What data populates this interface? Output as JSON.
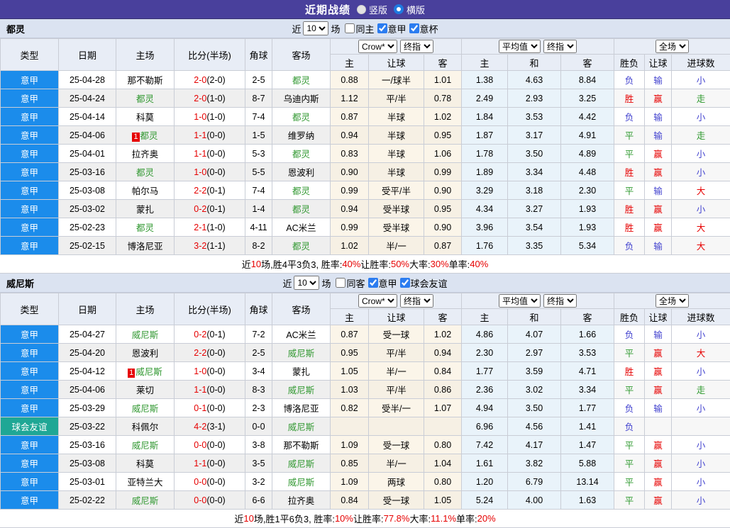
{
  "title_bar": {
    "title": "近期战绩",
    "vertical_label": "竖版",
    "horizontal_label": "横版",
    "vertical_selected": false,
    "horizontal_selected": true
  },
  "colors": {
    "titlebar_bg": "#49409c",
    "league_badge": "#1b8ceb",
    "friendly_badge": "#1fa795",
    "focus_team": "#339933",
    "win_red": "#e60000",
    "draw_green": "#2e992e",
    "lose_blue": "#4343cf",
    "odds_bg": "#fbf5e9",
    "avg_bg": "#e9f3fa"
  },
  "shared": {
    "filter": {
      "near": "近",
      "count": "10",
      "games": "场"
    },
    "dropdowns": {
      "bookmaker": "Crow*",
      "final_1": "终指",
      "average": "平均值",
      "final_2": "终指",
      "scope": "全场"
    },
    "columns": {
      "type": "类型",
      "date": "日期",
      "home": "主场",
      "score": "比分(半场)",
      "corner": "角球",
      "away": "客场",
      "odds_home": "主",
      "odds_handicap": "让球",
      "odds_away": "客",
      "avg_home": "主",
      "avg_draw": "和",
      "avg_away": "客",
      "wdl": "胜负",
      "handicap_result": "让球",
      "goals": "进球数"
    }
  },
  "tables": [
    {
      "team": "都灵",
      "filter_checkboxes": [
        {
          "label": "同主",
          "checked": false
        },
        {
          "label": "意甲",
          "checked": true
        },
        {
          "label": "意杯",
          "checked": true
        }
      ],
      "rows": [
        {
          "type": "意甲",
          "type_style": "league",
          "date": "25-04-28",
          "home": "那不勒斯",
          "home_focus": false,
          "home_badge": "",
          "score": "2-0",
          "half": "(2-0)",
          "corner": "2-5",
          "away": "都灵",
          "away_focus": true,
          "away_badge": "",
          "odds": [
            "0.88",
            "一/球半",
            "1.01"
          ],
          "avg": [
            "1.38",
            "4.63",
            "8.84"
          ],
          "results": [
            [
              "负",
              "b"
            ],
            [
              "输",
              "b"
            ],
            [
              "小",
              "b"
            ]
          ]
        },
        {
          "type": "意甲",
          "type_style": "league",
          "date": "25-04-24",
          "home": "都灵",
          "home_focus": true,
          "home_badge": "",
          "score": "2-0",
          "half": "(1-0)",
          "corner": "8-7",
          "away": "乌迪内斯",
          "away_focus": false,
          "away_badge": "",
          "odds": [
            "1.12",
            "平/半",
            "0.78"
          ],
          "avg": [
            "2.49",
            "2.93",
            "3.25"
          ],
          "results": [
            [
              "胜",
              "r"
            ],
            [
              "赢",
              "r"
            ],
            [
              "走",
              "g"
            ]
          ]
        },
        {
          "type": "意甲",
          "type_style": "league",
          "date": "25-04-14",
          "home": "科莫",
          "home_focus": false,
          "home_badge": "",
          "score": "1-0",
          "half": "(1-0)",
          "corner": "7-4",
          "away": "都灵",
          "away_focus": true,
          "away_badge": "",
          "odds": [
            "0.87",
            "半球",
            "1.02"
          ],
          "avg": [
            "1.84",
            "3.53",
            "4.42"
          ],
          "results": [
            [
              "负",
              "b"
            ],
            [
              "输",
              "b"
            ],
            [
              "小",
              "b"
            ]
          ]
        },
        {
          "type": "意甲",
          "type_style": "league",
          "date": "25-04-06",
          "home": "都灵",
          "home_focus": true,
          "home_badge": "1",
          "score": "1-1",
          "half": "(0-0)",
          "corner": "1-5",
          "away": "维罗纳",
          "away_focus": false,
          "away_badge": "",
          "odds": [
            "0.94",
            "半球",
            "0.95"
          ],
          "avg": [
            "1.87",
            "3.17",
            "4.91"
          ],
          "results": [
            [
              "平",
              "g"
            ],
            [
              "输",
              "b"
            ],
            [
              "走",
              "g"
            ]
          ]
        },
        {
          "type": "意甲",
          "type_style": "league",
          "date": "25-04-01",
          "home": "拉齐奥",
          "home_focus": false,
          "home_badge": "",
          "score": "1-1",
          "half": "(0-0)",
          "corner": "5-3",
          "away": "都灵",
          "away_focus": true,
          "away_badge": "",
          "odds": [
            "0.83",
            "半球",
            "1.06"
          ],
          "avg": [
            "1.78",
            "3.50",
            "4.89"
          ],
          "results": [
            [
              "平",
              "g"
            ],
            [
              "赢",
              "r"
            ],
            [
              "小",
              "b"
            ]
          ]
        },
        {
          "type": "意甲",
          "type_style": "league",
          "date": "25-03-16",
          "home": "都灵",
          "home_focus": true,
          "home_badge": "",
          "score": "1-0",
          "half": "(0-0)",
          "corner": "5-5",
          "away": "恩波利",
          "away_focus": false,
          "away_badge": "",
          "odds": [
            "0.90",
            "半球",
            "0.99"
          ],
          "avg": [
            "1.89",
            "3.34",
            "4.48"
          ],
          "results": [
            [
              "胜",
              "r"
            ],
            [
              "赢",
              "r"
            ],
            [
              "小",
              "b"
            ]
          ]
        },
        {
          "type": "意甲",
          "type_style": "league",
          "date": "25-03-08",
          "home": "帕尔马",
          "home_focus": false,
          "home_badge": "",
          "score": "2-2",
          "half": "(0-1)",
          "corner": "7-4",
          "away": "都灵",
          "away_focus": true,
          "away_badge": "",
          "odds": [
            "0.99",
            "受平/半",
            "0.90"
          ],
          "avg": [
            "3.29",
            "3.18",
            "2.30"
          ],
          "results": [
            [
              "平",
              "g"
            ],
            [
              "输",
              "b"
            ],
            [
              "大",
              "r"
            ]
          ]
        },
        {
          "type": "意甲",
          "type_style": "league",
          "date": "25-03-02",
          "home": "蒙扎",
          "home_focus": false,
          "home_badge": "",
          "score": "0-2",
          "half": "(0-1)",
          "corner": "1-4",
          "away": "都灵",
          "away_focus": true,
          "away_badge": "",
          "odds": [
            "0.94",
            "受半球",
            "0.95"
          ],
          "avg": [
            "4.34",
            "3.27",
            "1.93"
          ],
          "results": [
            [
              "胜",
              "r"
            ],
            [
              "赢",
              "r"
            ],
            [
              "小",
              "b"
            ]
          ]
        },
        {
          "type": "意甲",
          "type_style": "league",
          "date": "25-02-23",
          "home": "都灵",
          "home_focus": true,
          "home_badge": "",
          "score": "2-1",
          "half": "(1-0)",
          "corner": "4-11",
          "away": "AC米兰",
          "away_focus": false,
          "away_badge": "",
          "odds": [
            "0.99",
            "受半球",
            "0.90"
          ],
          "avg": [
            "3.96",
            "3.54",
            "1.93"
          ],
          "results": [
            [
              "胜",
              "r"
            ],
            [
              "赢",
              "r"
            ],
            [
              "大",
              "r"
            ]
          ]
        },
        {
          "type": "意甲",
          "type_style": "league",
          "date": "25-02-15",
          "home": "博洛尼亚",
          "home_focus": false,
          "home_badge": "",
          "score": "3-2",
          "half": "(1-1)",
          "corner": "8-2",
          "away": "都灵",
          "away_focus": true,
          "away_badge": "",
          "odds": [
            "1.02",
            "半/一",
            "0.87"
          ],
          "avg": [
            "1.76",
            "3.35",
            "5.34"
          ],
          "results": [
            [
              "负",
              "b"
            ],
            [
              "输",
              "b"
            ],
            [
              "大",
              "r"
            ]
          ]
        }
      ],
      "summary": [
        [
          "近",
          "k"
        ],
        [
          "10",
          "r"
        ],
        [
          "场,胜4平3负3, 胜率:",
          "k"
        ],
        [
          "40%",
          "r"
        ],
        [
          " 让胜率:",
          "k"
        ],
        [
          "50%",
          "r"
        ],
        [
          " 大率:",
          "k"
        ],
        [
          "30%",
          "r"
        ],
        [
          " 单率:",
          "k"
        ],
        [
          "40%",
          "r"
        ]
      ]
    },
    {
      "team": "威尼斯",
      "filter_checkboxes": [
        {
          "label": "同客",
          "checked": false
        },
        {
          "label": "意甲",
          "checked": true
        },
        {
          "label": "球会友谊",
          "checked": true
        }
      ],
      "rows": [
        {
          "type": "意甲",
          "type_style": "league",
          "date": "25-04-27",
          "home": "威尼斯",
          "home_focus": true,
          "home_badge": "",
          "score": "0-2",
          "half": "(0-1)",
          "corner": "7-2",
          "away": "AC米兰",
          "away_focus": false,
          "away_badge": "",
          "odds": [
            "0.87",
            "受一球",
            "1.02"
          ],
          "avg": [
            "4.86",
            "4.07",
            "1.66"
          ],
          "results": [
            [
              "负",
              "b"
            ],
            [
              "输",
              "b"
            ],
            [
              "小",
              "b"
            ]
          ]
        },
        {
          "type": "意甲",
          "type_style": "league",
          "date": "25-04-20",
          "home": "恩波利",
          "home_focus": false,
          "home_badge": "",
          "score": "2-2",
          "half": "(0-0)",
          "corner": "2-5",
          "away": "威尼斯",
          "away_focus": true,
          "away_badge": "",
          "odds": [
            "0.95",
            "平/半",
            "0.94"
          ],
          "avg": [
            "2.30",
            "2.97",
            "3.53"
          ],
          "results": [
            [
              "平",
              "g"
            ],
            [
              "赢",
              "r"
            ],
            [
              "大",
              "r"
            ]
          ]
        },
        {
          "type": "意甲",
          "type_style": "league",
          "date": "25-04-12",
          "home": "威尼斯",
          "home_focus": true,
          "home_badge": "1",
          "score": "1-0",
          "half": "(0-0)",
          "corner": "3-4",
          "away": "蒙扎",
          "away_focus": false,
          "away_badge": "",
          "odds": [
            "1.05",
            "半/一",
            "0.84"
          ],
          "avg": [
            "1.77",
            "3.59",
            "4.71"
          ],
          "results": [
            [
              "胜",
              "r"
            ],
            [
              "赢",
              "r"
            ],
            [
              "小",
              "b"
            ]
          ]
        },
        {
          "type": "意甲",
          "type_style": "league",
          "date": "25-04-06",
          "home": "莱切",
          "home_focus": false,
          "home_badge": "",
          "score": "1-1",
          "half": "(0-0)",
          "corner": "8-3",
          "away": "威尼斯",
          "away_focus": true,
          "away_badge": "",
          "odds": [
            "1.03",
            "平/半",
            "0.86"
          ],
          "avg": [
            "2.36",
            "3.02",
            "3.34"
          ],
          "results": [
            [
              "平",
              "g"
            ],
            [
              "赢",
              "r"
            ],
            [
              "走",
              "g"
            ]
          ]
        },
        {
          "type": "意甲",
          "type_style": "league",
          "date": "25-03-29",
          "home": "威尼斯",
          "home_focus": true,
          "home_badge": "",
          "score": "0-1",
          "half": "(0-0)",
          "corner": "2-3",
          "away": "博洛尼亚",
          "away_focus": false,
          "away_badge": "",
          "odds": [
            "0.82",
            "受半/一",
            "1.07"
          ],
          "avg": [
            "4.94",
            "3.50",
            "1.77"
          ],
          "results": [
            [
              "负",
              "b"
            ],
            [
              "输",
              "b"
            ],
            [
              "小",
              "b"
            ]
          ]
        },
        {
          "type": "球会友谊",
          "type_style": "friendly",
          "date": "25-03-22",
          "home": "科佩尔",
          "home_focus": false,
          "home_badge": "",
          "score": "4-2",
          "half": "(3-1)",
          "corner": "0-0",
          "away": "威尼斯",
          "away_focus": true,
          "away_badge": "",
          "odds": [
            "",
            "",
            ""
          ],
          "avg": [
            "6.96",
            "4.56",
            "1.41"
          ],
          "results": [
            [
              "负",
              "b"
            ],
            [
              "",
              ""
            ],
            [
              "",
              ""
            ]
          ]
        },
        {
          "type": "意甲",
          "type_style": "league",
          "date": "25-03-16",
          "home": "威尼斯",
          "home_focus": true,
          "home_badge": "",
          "score": "0-0",
          "half": "(0-0)",
          "corner": "3-8",
          "away": "那不勒斯",
          "away_focus": false,
          "away_badge": "",
          "odds": [
            "1.09",
            "受一球",
            "0.80"
          ],
          "avg": [
            "7.42",
            "4.17",
            "1.47"
          ],
          "results": [
            [
              "平",
              "g"
            ],
            [
              "赢",
              "r"
            ],
            [
              "小",
              "b"
            ]
          ]
        },
        {
          "type": "意甲",
          "type_style": "league",
          "date": "25-03-08",
          "home": "科莫",
          "home_focus": false,
          "home_badge": "",
          "score": "1-1",
          "half": "(0-0)",
          "corner": "3-5",
          "away": "威尼斯",
          "away_focus": true,
          "away_badge": "",
          "odds": [
            "0.85",
            "半/一",
            "1.04"
          ],
          "avg": [
            "1.61",
            "3.82",
            "5.88"
          ],
          "results": [
            [
              "平",
              "g"
            ],
            [
              "赢",
              "r"
            ],
            [
              "小",
              "b"
            ]
          ]
        },
        {
          "type": "意甲",
          "type_style": "league",
          "date": "25-03-01",
          "home": "亚特兰大",
          "home_focus": false,
          "home_badge": "",
          "score": "0-0",
          "half": "(0-0)",
          "corner": "3-2",
          "away": "威尼斯",
          "away_focus": true,
          "away_badge": "",
          "odds": [
            "1.09",
            "两球",
            "0.80"
          ],
          "avg": [
            "1.20",
            "6.79",
            "13.14"
          ],
          "results": [
            [
              "平",
              "g"
            ],
            [
              "赢",
              "r"
            ],
            [
              "小",
              "b"
            ]
          ]
        },
        {
          "type": "意甲",
          "type_style": "league",
          "date": "25-02-22",
          "home": "威尼斯",
          "home_focus": true,
          "home_badge": "",
          "score": "0-0",
          "half": "(0-0)",
          "corner": "6-6",
          "away": "拉齐奥",
          "away_focus": false,
          "away_badge": "",
          "odds": [
            "0.84",
            "受一球",
            "1.05"
          ],
          "avg": [
            "5.24",
            "4.00",
            "1.63"
          ],
          "results": [
            [
              "平",
              "g"
            ],
            [
              "赢",
              "r"
            ],
            [
              "小",
              "b"
            ]
          ]
        }
      ],
      "summary": [
        [
          "近",
          "k"
        ],
        [
          "10",
          "r"
        ],
        [
          "场,胜1平6负3, 胜率:",
          "k"
        ],
        [
          "10%",
          "r"
        ],
        [
          " 让胜率:",
          "k"
        ],
        [
          "77.8%",
          "r"
        ],
        [
          " 大率:",
          "k"
        ],
        [
          "11.1%",
          "r"
        ],
        [
          " 单率:",
          "k"
        ],
        [
          "20%",
          "r"
        ]
      ]
    }
  ]
}
